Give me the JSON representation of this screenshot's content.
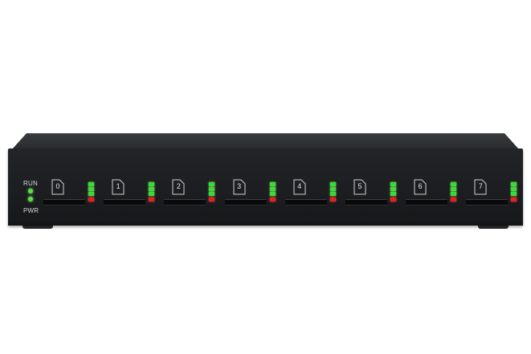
{
  "device": {
    "status_labels": {
      "run": "RUN",
      "pwr": "PWR"
    },
    "slots": [
      {
        "label": "0"
      },
      {
        "label": "1"
      },
      {
        "label": "2"
      },
      {
        "label": "3"
      },
      {
        "label": "4"
      },
      {
        "label": "5"
      },
      {
        "label": "6"
      },
      {
        "label": "7"
      }
    ],
    "colors": {
      "chassis": "#1c1d20",
      "led_green": "#3fd838",
      "led_red": "#e3201e",
      "status_led": "#5ce04a"
    },
    "icons": {
      "sim": "sim-card-icon",
      "slot": "card-slot"
    }
  }
}
